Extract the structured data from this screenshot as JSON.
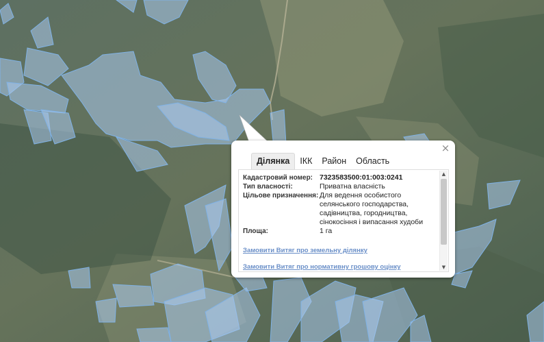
{
  "popup": {
    "close_glyph": "×",
    "tabs": [
      {
        "label": "Ділянка",
        "active": true
      },
      {
        "label": "ІКК",
        "active": false
      },
      {
        "label": "Район",
        "active": false
      },
      {
        "label": "Область",
        "active": false
      }
    ],
    "fields": [
      {
        "key": "Кадастровий номер:",
        "value": "7323583500:01:003:0241"
      },
      {
        "key": "Тип власності:",
        "value": "Приватна власність"
      },
      {
        "key": "Цільове призначення:",
        "value": "Для ведення особистого селянського господарства, садівництва, городництва, сінокосіння і випасання худоби"
      },
      {
        "key": "Площа:",
        "value": "1 га"
      }
    ],
    "links": [
      "Замовити Витяг про земельну ділянку",
      "Замовити Витяг про нормативну грошову оцінку"
    ]
  },
  "colors": {
    "parcel_fill": "#a9c8ec",
    "parcel_stroke": "#7fb2e6",
    "link": "#6a8fc8"
  }
}
